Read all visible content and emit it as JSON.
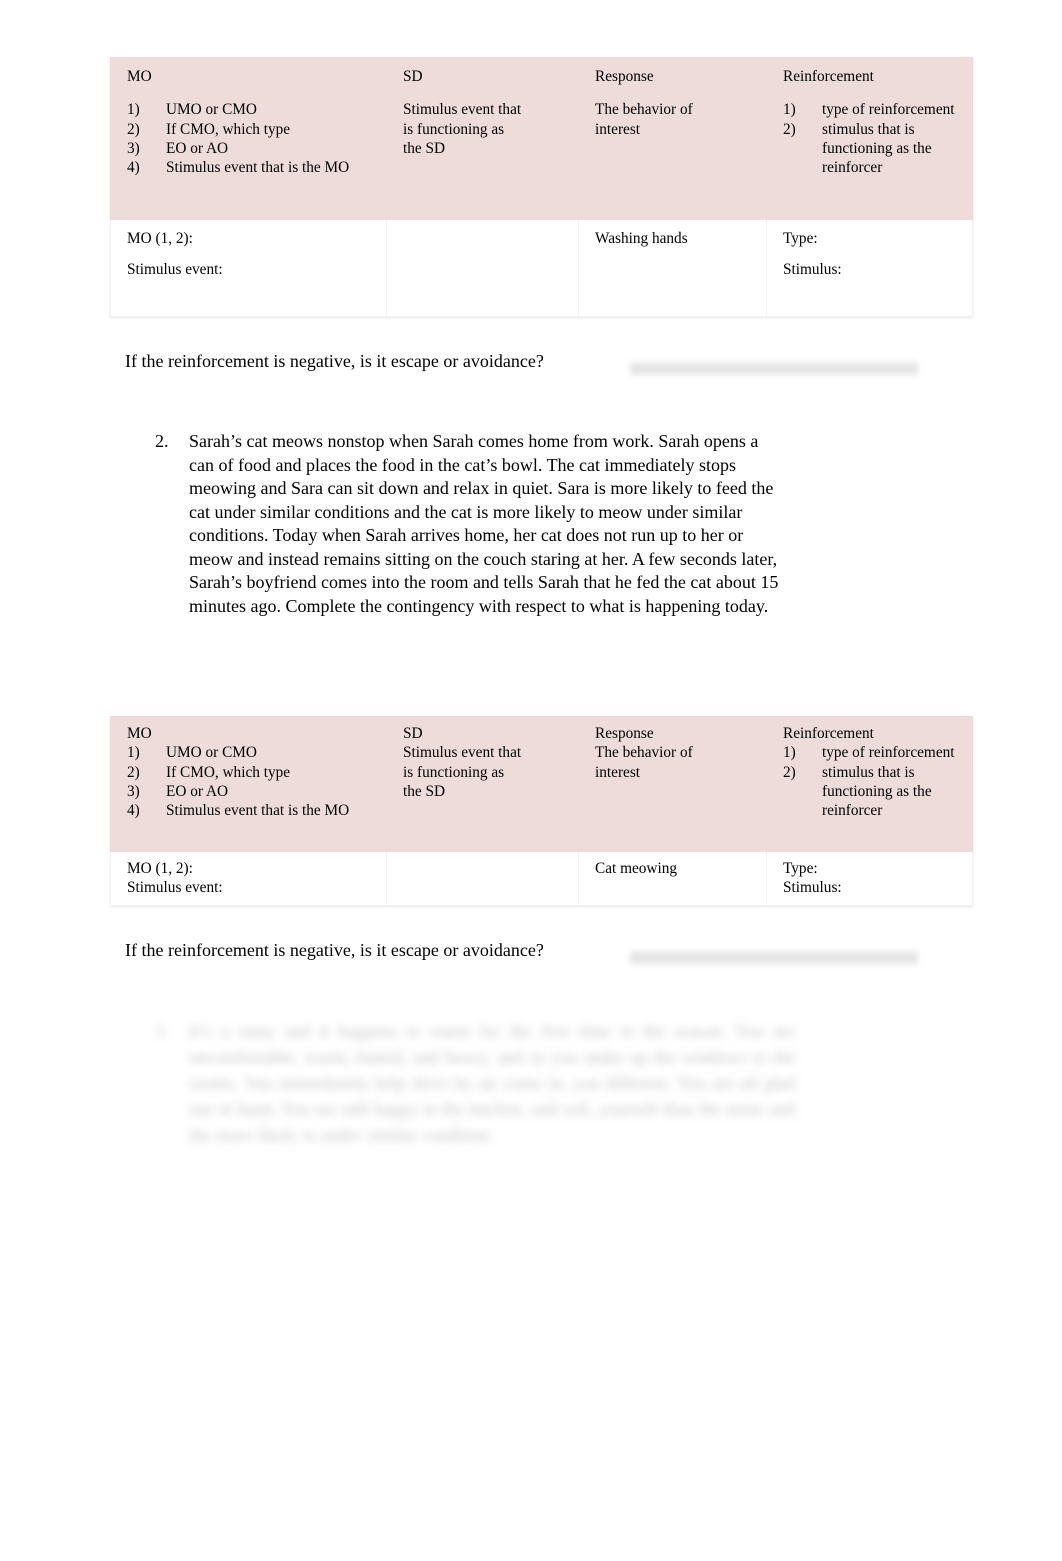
{
  "document": {
    "page_background": "#ffffff",
    "header_fill": "#eedcda"
  },
  "table_header": {
    "mo": {
      "title": "MO",
      "items": [
        {
          "num": "1)",
          "text": "UMO or CMO"
        },
        {
          "num": "2)",
          "text": "If CMO, which type"
        },
        {
          "num": "3)",
          "text": "EO or AO"
        },
        {
          "num": "4)",
          "text": "Stimulus event that is the MO"
        }
      ]
    },
    "sd": {
      "title": "SD",
      "lines": [
        "Stimulus event that",
        "is functioning as",
        "the SD"
      ]
    },
    "response": {
      "title": "Response",
      "lines": [
        "The behavior of",
        "interest"
      ]
    },
    "reinforcement": {
      "title": "Reinforcement",
      "items": [
        {
          "num": "1)",
          "text": "type of reinforcement"
        },
        {
          "num": "2)",
          "text": "stimulus that is functioning as the reinforcer"
        }
      ]
    }
  },
  "table_1": {
    "mo_cell": {
      "line1": "MO (1, 2):",
      "line2": "Stimulus event:"
    },
    "sd_cell": "",
    "response_cell": "Washing hands",
    "reinforcement_cell": {
      "line1": "Type:",
      "line2": "Stimulus:"
    }
  },
  "table_2": {
    "mo_cell": {
      "line1": "MO (1, 2):",
      "line2": "Stimulus event:"
    },
    "sd_cell": "",
    "response_cell": "Cat meowing",
    "reinforcement_cell": {
      "line1": "Type:",
      "line2": "Stimulus:"
    }
  },
  "questions": {
    "negative_reinforcement_1": "If the reinforcement is negative, is it escape or avoidance?",
    "negative_reinforcement_2": "If the reinforcement is negative, is it escape or avoidance?"
  },
  "scenario_2": {
    "number": "2.",
    "text": "Sarah’s cat meows nonstop when Sarah comes home from work. Sarah opens a can of food and places the food in the cat’s bowl. The cat immediately stops meowing and Sara can sit down and relax in quiet. Sara is more likely to feed the cat under similar conditions and the cat is more likely to meow under similar conditions. Today when Sarah arrives home, her cat does not run up to her or meow and instead remains sitting on the couch staring at her. A few seconds later, Sarah’s boyfriend comes into the room and tells Sarah that he fed the cat about 15 minutes ago. Complete the contingency with respect to what is happening today."
  },
  "scenario_3": {
    "number": "3.",
    "text": "It’s a rainy and it happens to warm for the first time in the season. You are uncomfortable, warm, humid, and heavy, and so you make up the windows to the rooms. You immediately help drive by air come in, you different. You are all glad out of hand. You are still happy in the kitchen, and soft, yourself than the noise and the more likely to under similar condition."
  }
}
